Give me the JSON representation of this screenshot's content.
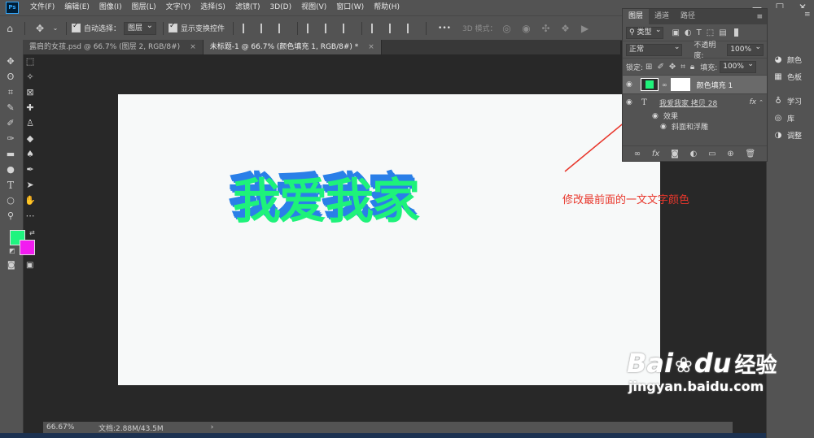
{
  "app": {
    "logo": "Ps"
  },
  "menu": [
    "文件(F)",
    "编辑(E)",
    "图像(I)",
    "图层(L)",
    "文字(Y)",
    "选择(S)",
    "滤镜(T)",
    "3D(D)",
    "视图(V)",
    "窗口(W)",
    "帮助(H)"
  ],
  "window_controls": {
    "minimize": "—",
    "maximize": "☐",
    "close": "✕"
  },
  "options": {
    "auto_select_label": "自动选择：",
    "auto_select_value": "图层",
    "show_transform_label": "显示变换控件",
    "more": "•••",
    "mode_3d_label": "3D 模式："
  },
  "tabs": [
    {
      "label": "露肩的女孩.psd @ 66.7% (图层 2, RGB/8#)",
      "close": "×"
    },
    {
      "label": "未标题-1 @ 66.7% (颜色填充 1, RGB/8#) *",
      "close": "×"
    }
  ],
  "artwork": {
    "text": "我爱我家",
    "front_color": "#1ef27a",
    "shadow_color": "#2a7fe8",
    "canvas_color": "#f7f9f9"
  },
  "annotation": {
    "text": "修改最前面的一文文字颜色",
    "color": "#e8372c"
  },
  "swatches": {
    "foreground": "#1ff47f",
    "background": "#f21cf0"
  },
  "status": {
    "zoom": "66.67%",
    "doc": "文档:2.88M/43.5M",
    "arrow": "›"
  },
  "layers_panel": {
    "tabs": [
      "图层",
      "通道",
      "路径"
    ],
    "filter_label": "类型",
    "blend_mode": "正常",
    "opacity_label": "不透明度:",
    "opacity_value": "100%",
    "lock_label": "锁定:",
    "fill_label": "填充:",
    "fill_value": "100%",
    "layers": [
      {
        "name": "颜色填充 1",
        "swatch": "#1ef27a"
      },
      {
        "name": "我爱我家 拷贝 28",
        "type_icon": "T",
        "fx": "fx"
      }
    ],
    "effects_label": "效果",
    "effect_item": "斜面和浮雕"
  },
  "dock": {
    "items": [
      {
        "label": "颜色",
        "icon": "palette-icon"
      },
      {
        "label": "色板",
        "icon": "grid-icon"
      },
      {
        "label": "学习",
        "icon": "bulb-icon"
      },
      {
        "label": "库",
        "icon": "library-icon"
      },
      {
        "label": "调整",
        "icon": "adjust-icon"
      }
    ]
  },
  "watermark": {
    "brand": "Bai",
    "brand_suffix": "du",
    "brand_cn": "经验",
    "url": "jingyan.baidu.com"
  }
}
